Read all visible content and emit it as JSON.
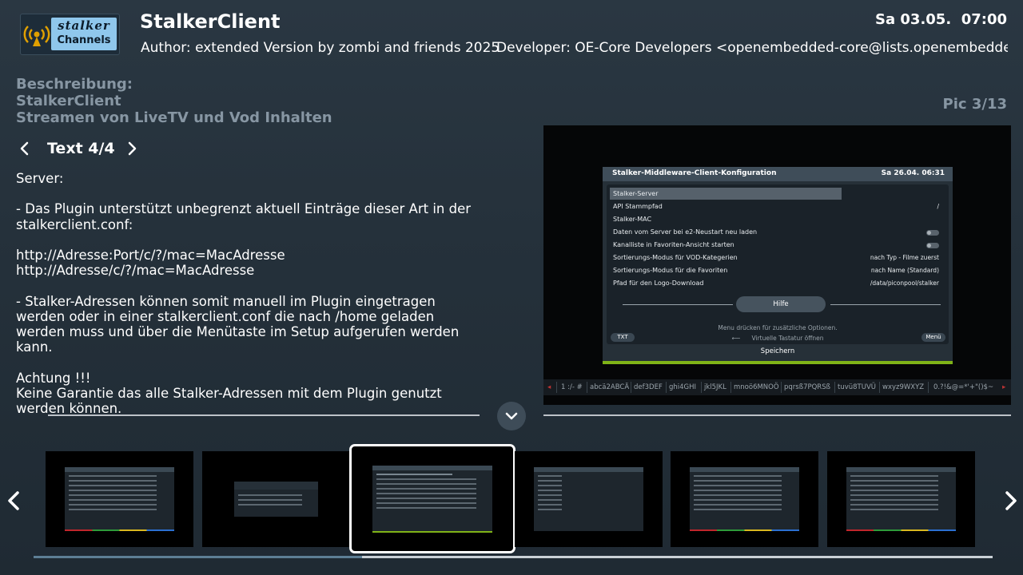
{
  "header": {
    "logo_text_1": "stalker",
    "logo_text_2": "Channels",
    "title": "StalkerClient",
    "datetime": "Sa 03.05.  07:00",
    "author": "Author: extended Version by zombi and friends 2025",
    "developer": "Developer: OE-Core Developers <openembedded-core@lists.openembedded ..."
  },
  "description": {
    "line1": "Beschreibung:",
    "line2": "StalkerClient",
    "line3": "Streamen von LiveTV und Vod Inhalten"
  },
  "pic_counter": "Pic 3/13",
  "text_nav": {
    "label": "Text 4/4"
  },
  "body_text": {
    "p1": "Server:",
    "p2": "- Das Plugin unterstützt unbegrenzt aktuell Einträge dieser Art in der stalkerclient.conf:",
    "p3a": "http://Adresse:Port/c/?/mac=MacAdresse",
    "p3b": "http://Adresse/c/?/mac=MacAdresse",
    "p4": "- Stalker-Adressen können somit manuell im Plugin eingetragen werden oder in einer stalkerclient.conf die nach /home geladen werden muss und über die Menütaste im Setup aufgerufen werden kann.",
    "p5a": "Achtung !!!",
    "p5b": "Keine Garantie das alle Stalker-Adressen mit dem Plugin genutzt werden können."
  },
  "preview": {
    "dialog_title": "Stalker-Middleware-Client-Konfiguration",
    "dialog_date": "Sa 26.04.  06:31",
    "rows": [
      {
        "label": "Stalker-Server",
        "value": ""
      },
      {
        "label": "API Stammpfad",
        "value": "/"
      },
      {
        "label": "Stalker-MAC",
        "value": ""
      },
      {
        "label": "Daten vom Server bei e2-Neustart neu laden",
        "value": ""
      },
      {
        "label": "Kanalliste in Favoriten-Ansicht starten",
        "value": ""
      },
      {
        "label": "Sortierungs-Modus für VOD-Kategerien",
        "value": "nach Typ - Filme zuerst"
      },
      {
        "label": "Sortierungs-Modus für die Favoriten",
        "value": "nach Name (Standard)"
      },
      {
        "label": "Pfad für den Logo-Download",
        "value": "/data/piconpool/stalker"
      }
    ],
    "help_button": "Hilfe",
    "hint1": "Menu drücken für zusätzliche Optionen.",
    "hint2": "Virtuelle Tastatur öffnen",
    "txt_button": "TXT",
    "menu_button": "Menü",
    "save_label": "Speichern",
    "keyboard_keys": [
      "1 :/- #",
      "abcä2ABCÄ",
      "def3DEF",
      "ghi4GHI",
      "jkl5JKL",
      "mnoö6MNOÖ",
      "pqrsß7PQRSß",
      "tuvü8TUVÜ",
      "wxyz9WXYZ",
      "0.?!&@=*'+\"()$~"
    ]
  },
  "colors": {
    "accent_green": "#7fb317",
    "muted_text": "#8796a3",
    "selection_border": "#ffffff"
  },
  "thumbnails": {
    "count_visible": 6,
    "selected_index": 3
  },
  "scrollbar": {
    "progress": 0.3425
  }
}
